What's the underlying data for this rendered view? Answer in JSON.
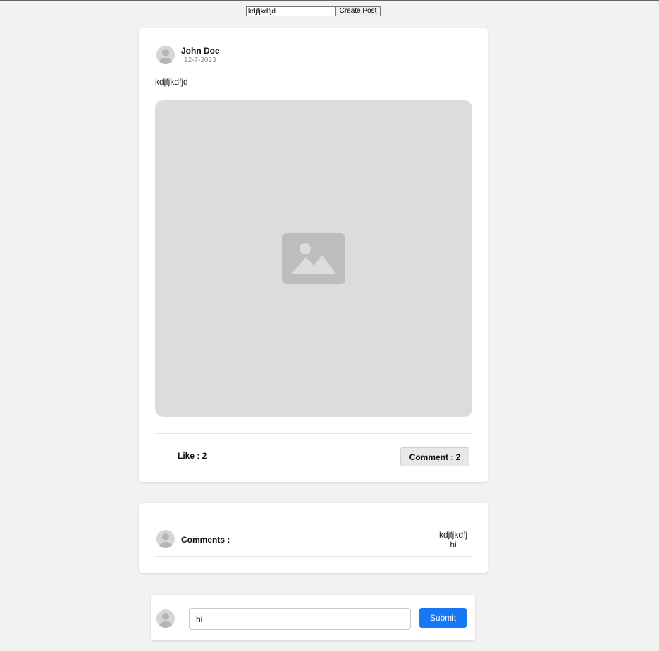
{
  "create_post": {
    "input_value": "kdjfjkdfjd",
    "button_label": "Create Post"
  },
  "post": {
    "author_name": "John Doe",
    "date": "12-7-2023",
    "text": "kdjfjkdfjd",
    "image_icon": "image-placeholder-icon",
    "like_label": "Like : 2",
    "comment_button_label": "Comment : 2"
  },
  "comments": {
    "label": "Comments :",
    "items": [
      "kdjfjkdfj",
      "hi"
    ]
  },
  "reply": {
    "input_value": "hi",
    "submit_label": "Submit"
  },
  "colors": {
    "background": "#f2f2f2",
    "card": "#ffffff",
    "accent": "#1877f2",
    "image_placeholder": "#dcdcdc"
  }
}
